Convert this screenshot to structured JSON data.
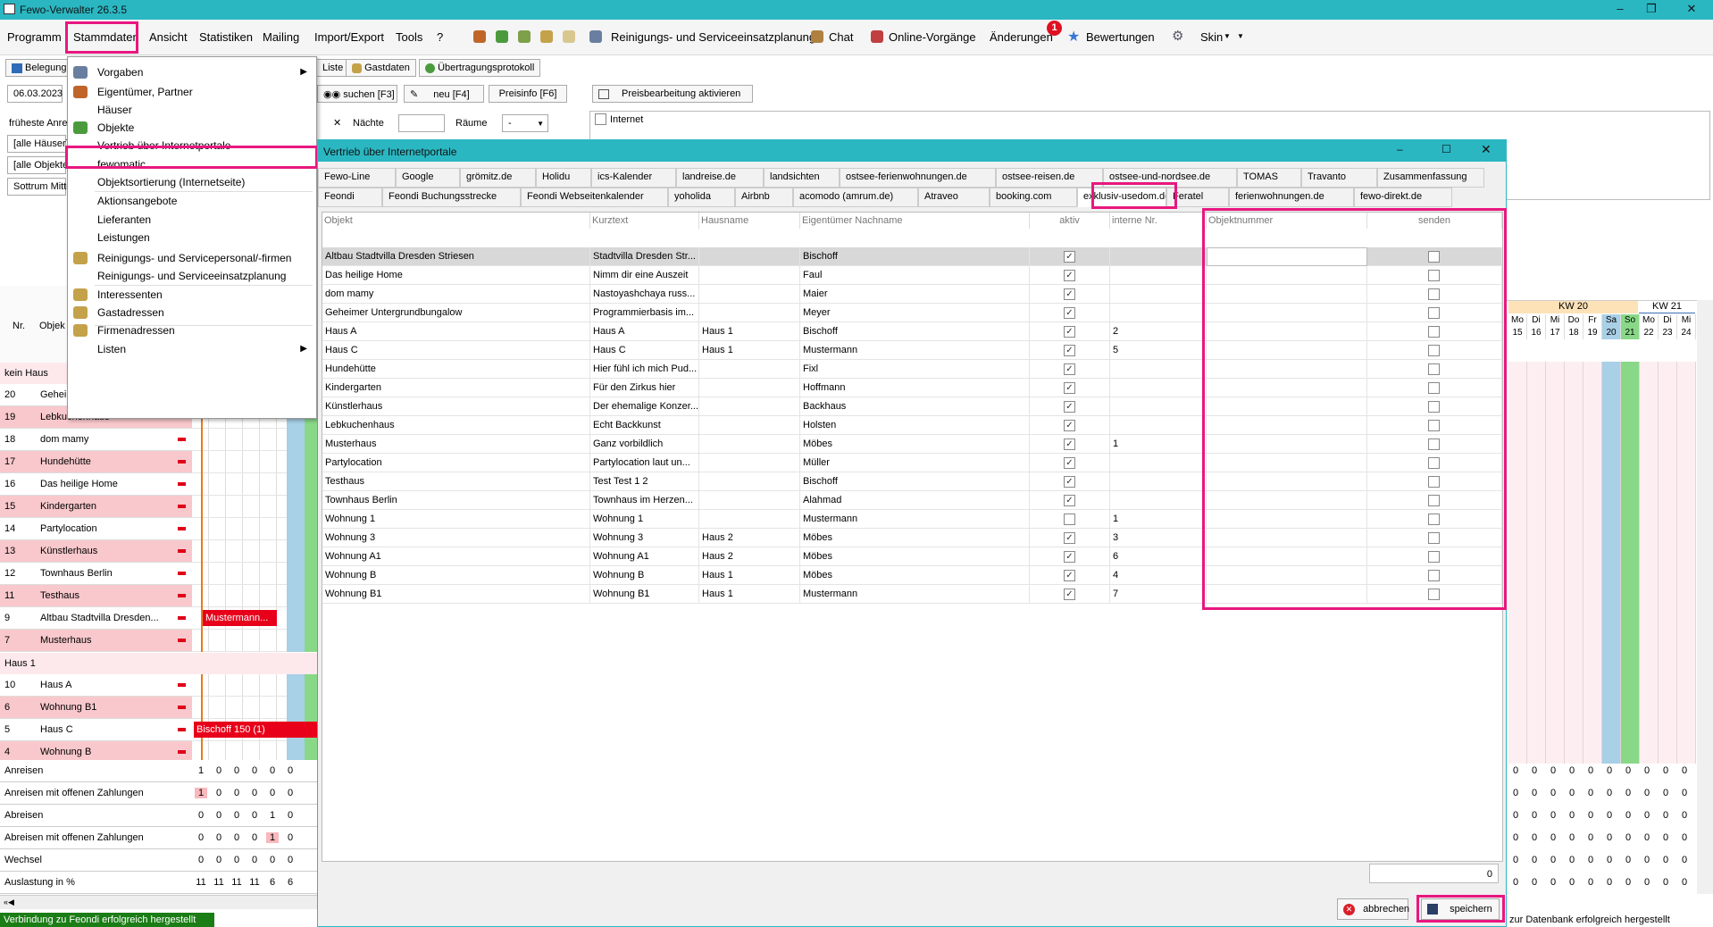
{
  "window": {
    "title": "Fewo-Verwalter 26.3.5"
  },
  "menu": {
    "items": [
      "Programm",
      "Stammdaten",
      "Ansicht",
      "Statistiken",
      "Mailing",
      "Import/Export",
      "Tools",
      "?"
    ],
    "right_items": [
      "Reinigungs- und Serviceeinsatzplanung",
      "Chat",
      "Online-Vorgänge",
      "Änderungen",
      "Bewertungen",
      "Skin"
    ],
    "badge": "1"
  },
  "toolbar": {
    "belegung": "Belegung",
    "liste": "Liste",
    "gastdaten": "Gastdaten",
    "uebertragungsprotokoll": "Übertragungsprotokoll",
    "date": "06.03.2023",
    "suchen": "suchen [F3]",
    "neu": "neu [F4]",
    "preisinfo": "Preisinfo [F6]",
    "preisbearbeitung": "Preisbearbeitung aktivieren",
    "naechte": "Nächte",
    "raeume": "Räume",
    "raeume_value": "-",
    "internet": "Internet"
  },
  "left": {
    "frueheste": "früheste Anrei",
    "filter1": "[alle Häuser]",
    "filter2": "[alle Objekte]",
    "filter3": "Sottrum Mitte",
    "col_nr": "Nr.",
    "col_obj": "Objek",
    "group1": "kein Haus",
    "group2": "Haus 1",
    "rows": [
      {
        "nr": "20",
        "name": "Gehei",
        "pink": false
      },
      {
        "nr": "19",
        "name": "Lebkuchenhaus",
        "pink": true
      },
      {
        "nr": "18",
        "name": "dom mamy",
        "pink": false
      },
      {
        "nr": "17",
        "name": "Hundehütte",
        "pink": true
      },
      {
        "nr": "16",
        "name": "Das heilige Home",
        "pink": false
      },
      {
        "nr": "15",
        "name": "Kindergarten",
        "pink": true
      },
      {
        "nr": "14",
        "name": "Partylocation",
        "pink": false
      },
      {
        "nr": "13",
        "name": "Künstlerhaus",
        "pink": true
      },
      {
        "nr": "12",
        "name": "Townhaus Berlin",
        "pink": false
      },
      {
        "nr": "11",
        "name": "Testhaus",
        "pink": true
      },
      {
        "nr": "9",
        "name": "Altbau Stadtvilla Dresden...",
        "pink": false
      },
      {
        "nr": "7",
        "name": "Musterhaus",
        "pink": true
      }
    ],
    "rows2": [
      {
        "nr": "10",
        "name": "Haus A",
        "pink": false
      },
      {
        "nr": "6",
        "name": "Wohnung B1",
        "pink": true
      },
      {
        "nr": "5",
        "name": "Haus C",
        "pink": false
      },
      {
        "nr": "4",
        "name": "Wohnung B",
        "pink": true
      }
    ],
    "bookings": [
      "Mustermann...",
      "Bischoff 150 (1)"
    ],
    "summary": [
      {
        "label": "Anreisen",
        "values": [
          "1",
          "0",
          "0",
          "0",
          "0",
          "0"
        ]
      },
      {
        "label": "Anreisen mit offenen Zahlungen",
        "values": [
          "1",
          "0",
          "0",
          "0",
          "0",
          "0"
        ]
      },
      {
        "label": "Abreisen",
        "values": [
          "0",
          "0",
          "0",
          "0",
          "1",
          "0"
        ]
      },
      {
        "label": "Abreisen mit offenen Zahlungen",
        "values": [
          "0",
          "0",
          "0",
          "0",
          "1",
          "0"
        ]
      },
      {
        "label": "Wechsel",
        "values": [
          "0",
          "0",
          "0",
          "0",
          "0",
          "0"
        ]
      },
      {
        "label": "Auslastung in %",
        "values": [
          "11",
          "11",
          "11",
          "11",
          "6",
          "6"
        ]
      }
    ]
  },
  "dropdown": {
    "items": [
      {
        "label": "Vorgaben",
        "arrow": true,
        "icon": "grid-icon"
      },
      {
        "label": "Eigentümer, Partner",
        "icon": "owner-icon"
      },
      {
        "label": "Häuser"
      },
      {
        "label": "Objekte",
        "icon": "house-icon"
      },
      {
        "label": "Vertrieb über Internetportale"
      },
      {
        "label": "fewomatic"
      },
      {
        "label": "Objektsortierung (Internetseite)"
      },
      {
        "label": "Aktionsangebote"
      },
      {
        "label": "Lieferanten"
      },
      {
        "label": "Leistungen"
      },
      {
        "label": "Reinigungs- und Servicepersonal/-firmen",
        "icon": "person-icon"
      },
      {
        "label": "Reinigungs- und Serviceeinsatzplanung"
      },
      {
        "label": "Interessenten",
        "icon": "person-icon"
      },
      {
        "label": "Gastadressen",
        "icon": "person-icon"
      },
      {
        "label": "Firmenadressen",
        "icon": "person-icon"
      },
      {
        "label": "Listen",
        "arrow": true
      }
    ]
  },
  "dialog": {
    "title": "Vertrieb über Internetportale",
    "tabs_row1": [
      "Fewo-Line",
      "Google",
      "grömitz.de",
      "Holidu",
      "ics-Kalender",
      "landreise.de",
      "landsichten",
      "ostsee-ferienwohnungen.de",
      "ostsee-reisen.de",
      "ostsee-und-nordsee.de",
      "TOMAS",
      "Travanto",
      "Zusammenfassung"
    ],
    "tabs_row2": [
      "Feondi",
      "Feondi Buchungsstrecke",
      "Feondi Webseitenkalender",
      "yoholida",
      "Airbnb",
      "acomodo (amrum.de)",
      "Atraveo",
      "booking.com",
      "exklusiv-usedom.de",
      "Feratel",
      "ferienwohnungen.de",
      "fewo-direkt.de"
    ],
    "columns": [
      "Objekt",
      "Kurztext",
      "Hausname",
      "Eigentümer Nachname",
      "aktiv",
      "interne Nr.",
      "Objektnummer",
      "senden"
    ],
    "rows": [
      {
        "objekt": "Altbau Stadtvilla Dresden Striesen",
        "kurz": "Stadtvilla Dresden Str...",
        "haus": "",
        "eig": "Bischoff",
        "aktiv": true,
        "nr": ""
      },
      {
        "objekt": "Das heilige Home",
        "kurz": "Nimm dir eine Auszeit",
        "haus": "",
        "eig": "Faul",
        "aktiv": true,
        "nr": ""
      },
      {
        "objekt": "dom mamy",
        "kurz": "Nastoyashchaya russ...",
        "haus": "",
        "eig": "Maier",
        "aktiv": true,
        "nr": ""
      },
      {
        "objekt": "Geheimer Untergrundbungalow",
        "kurz": "Programmierbasis im...",
        "haus": "",
        "eig": "Meyer",
        "aktiv": true,
        "nr": ""
      },
      {
        "objekt": "Haus A",
        "kurz": "Haus A",
        "haus": "Haus 1",
        "eig": "Bischoff",
        "aktiv": true,
        "nr": "2"
      },
      {
        "objekt": "Haus C",
        "kurz": "Haus C",
        "haus": "Haus 1",
        "eig": "Mustermann",
        "aktiv": true,
        "nr": "5"
      },
      {
        "objekt": "Hundehütte",
        "kurz": "Hier fühl ich mich Pud...",
        "haus": "",
        "eig": "Fixl",
        "aktiv": true,
        "nr": ""
      },
      {
        "objekt": "Kindergarten",
        "kurz": "Für den Zirkus hier",
        "haus": "",
        "eig": "Hoffmann",
        "aktiv": true,
        "nr": ""
      },
      {
        "objekt": "Künstlerhaus",
        "kurz": "Der ehemalige Konzer...",
        "haus": "",
        "eig": "Backhaus",
        "aktiv": true,
        "nr": ""
      },
      {
        "objekt": "Lebkuchenhaus",
        "kurz": "Echt Backkunst",
        "haus": "",
        "eig": "Holsten",
        "aktiv": true,
        "nr": ""
      },
      {
        "objekt": "Musterhaus",
        "kurz": "Ganz vorbildlich",
        "haus": "",
        "eig": "Möbes",
        "aktiv": true,
        "nr": "1"
      },
      {
        "objekt": "Partylocation",
        "kurz": "Partylocation laut un...",
        "haus": "",
        "eig": "Müller",
        "aktiv": true,
        "nr": ""
      },
      {
        "objekt": "Testhaus",
        "kurz": "Test Test 1 2",
        "haus": "",
        "eig": "Bischoff",
        "aktiv": true,
        "nr": ""
      },
      {
        "objekt": "Townhaus Berlin",
        "kurz": "Townhaus im Herzen...",
        "haus": "",
        "eig": "Alahmad",
        "aktiv": true,
        "nr": ""
      },
      {
        "objekt": "Wohnung 1",
        "kurz": "Wohnung 1",
        "haus": "",
        "eig": "Mustermann",
        "aktiv": false,
        "nr": "1"
      },
      {
        "objekt": "Wohnung 3",
        "kurz": "Wohnung 3",
        "haus": "Haus 2",
        "eig": "Möbes",
        "aktiv": true,
        "nr": "3"
      },
      {
        "objekt": "Wohnung A1",
        "kurz": "Wohnung A1",
        "haus": "Haus 2",
        "eig": "Möbes",
        "aktiv": true,
        "nr": "6"
      },
      {
        "objekt": "Wohnung B",
        "kurz": "Wohnung B",
        "haus": "Haus 1",
        "eig": "Möbes",
        "aktiv": true,
        "nr": "4"
      },
      {
        "objekt": "Wohnung B1",
        "kurz": "Wohnung B1",
        "haus": "Haus 1",
        "eig": "Mustermann",
        "aktiv": true,
        "nr": "7"
      }
    ],
    "count": "0",
    "cancel": "abbrechen",
    "save": "speichern"
  },
  "calendar": {
    "kw20": "KW 20",
    "kw21": "KW 21",
    "days": [
      "Mo",
      "Di",
      "Mi",
      "Do",
      "Fr",
      "Sa",
      "So",
      "Mo",
      "Di",
      "Mi"
    ],
    "dates": [
      "15",
      "16",
      "17",
      "18",
      "19",
      "20",
      "21",
      "22",
      "23",
      "24"
    ]
  },
  "status": {
    "left": "Verbindung zu Feondi erfolgreich hergestellt",
    "right": "zur Datenbank erfolgreich hergestellt"
  }
}
